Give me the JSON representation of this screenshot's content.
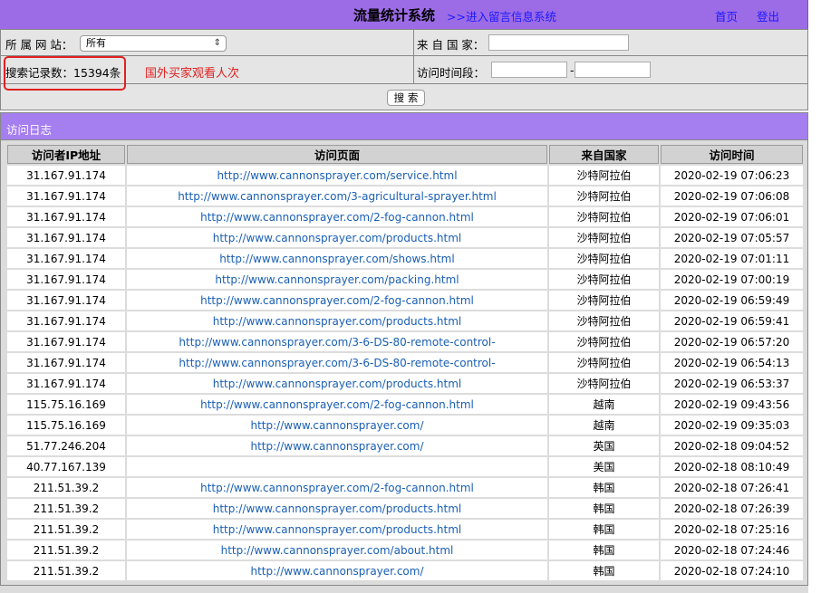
{
  "header": {
    "title": "流量统计系统",
    "enter_link": ">>进入留言信息系统",
    "home": "首页",
    "logout": "登出",
    "accent": "#9c6be6"
  },
  "filters": {
    "site_label": "所 属 网 站：",
    "site_selected": "所有",
    "country_label": "来 自 国 家：",
    "country_value": "",
    "count_text": "搜索记录数：15394条",
    "note": "国外买家观看人次",
    "time_label": "访问时间段：",
    "time_start": "",
    "time_sep": "-",
    "time_end": "",
    "search_button": "搜 索"
  },
  "log": {
    "title": "访问日志",
    "columns": [
      "访问者IP地址",
      "访问页面",
      "来自国家",
      "访问时间"
    ],
    "rows": [
      {
        "ip": "31.167.91.174",
        "page": "http://www.cannonsprayer.com/service.html",
        "country": "沙特阿拉伯",
        "time": "2020-02-19 07:06:23"
      },
      {
        "ip": "31.167.91.174",
        "page": "http://www.cannonsprayer.com/3-agricultural-sprayer.html",
        "country": "沙特阿拉伯",
        "time": "2020-02-19 07:06:08"
      },
      {
        "ip": "31.167.91.174",
        "page": "http://www.cannonsprayer.com/2-fog-cannon.html",
        "country": "沙特阿拉伯",
        "time": "2020-02-19 07:06:01"
      },
      {
        "ip": "31.167.91.174",
        "page": "http://www.cannonsprayer.com/products.html",
        "country": "沙特阿拉伯",
        "time": "2020-02-19 07:05:57"
      },
      {
        "ip": "31.167.91.174",
        "page": "http://www.cannonsprayer.com/shows.html",
        "country": "沙特阿拉伯",
        "time": "2020-02-19 07:01:11"
      },
      {
        "ip": "31.167.91.174",
        "page": "http://www.cannonsprayer.com/packing.html",
        "country": "沙特阿拉伯",
        "time": "2020-02-19 07:00:19"
      },
      {
        "ip": "31.167.91.174",
        "page": "http://www.cannonsprayer.com/2-fog-cannon.html",
        "country": "沙特阿拉伯",
        "time": "2020-02-19 06:59:49"
      },
      {
        "ip": "31.167.91.174",
        "page": "http://www.cannonsprayer.com/products.html",
        "country": "沙特阿拉伯",
        "time": "2020-02-19 06:59:41"
      },
      {
        "ip": "31.167.91.174",
        "page": "http://www.cannonsprayer.com/3-6-DS-80-remote-control-",
        "country": "沙特阿拉伯",
        "time": "2020-02-19 06:57:20"
      },
      {
        "ip": "31.167.91.174",
        "page": "http://www.cannonsprayer.com/3-6-DS-80-remote-control-",
        "country": "沙特阿拉伯",
        "time": "2020-02-19 06:54:13"
      },
      {
        "ip": "31.167.91.174",
        "page": "http://www.cannonsprayer.com/products.html",
        "country": "沙特阿拉伯",
        "time": "2020-02-19 06:53:37"
      },
      {
        "ip": "115.75.16.169",
        "page": "http://www.cannonsprayer.com/2-fog-cannon.html",
        "country": "越南",
        "time": "2020-02-19 09:43:56"
      },
      {
        "ip": "115.75.16.169",
        "page": "http://www.cannonsprayer.com/",
        "country": "越南",
        "time": "2020-02-19 09:35:03"
      },
      {
        "ip": "51.77.246.204",
        "page": "http://www.cannonsprayer.com/",
        "country": "英国",
        "time": "2020-02-18 09:04:52"
      },
      {
        "ip": "40.77.167.139",
        "page": "",
        "country": "美国",
        "time": "2020-02-18 08:10:49"
      },
      {
        "ip": "211.51.39.2",
        "page": "http://www.cannonsprayer.com/2-fog-cannon.html",
        "country": "韩国",
        "time": "2020-02-18 07:26:41"
      },
      {
        "ip": "211.51.39.2",
        "page": "http://www.cannonsprayer.com/products.html",
        "country": "韩国",
        "time": "2020-02-18 07:26:39"
      },
      {
        "ip": "211.51.39.2",
        "page": "http://www.cannonsprayer.com/products.html",
        "country": "韩国",
        "time": "2020-02-18 07:25:16"
      },
      {
        "ip": "211.51.39.2",
        "page": "http://www.cannonsprayer.com/about.html",
        "country": "韩国",
        "time": "2020-02-18 07:24:46"
      },
      {
        "ip": "211.51.39.2",
        "page": "http://www.cannonsprayer.com/",
        "country": "韩国",
        "time": "2020-02-18 07:24:10"
      }
    ]
  }
}
